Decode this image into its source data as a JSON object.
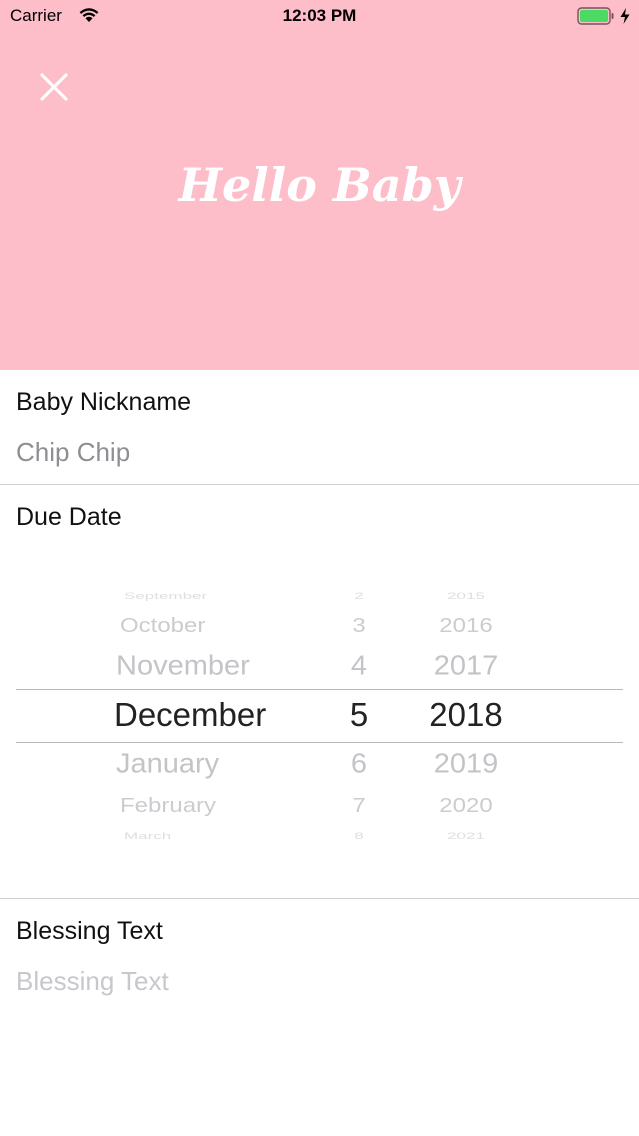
{
  "status_bar": {
    "carrier": "Carrier",
    "time": "12:03 PM",
    "wifi_icon": "wifi-icon",
    "battery_icon": "battery-icon",
    "charge_icon": "charging-bolt-icon",
    "battery_level": 1.0
  },
  "header": {
    "background_color": "#fdbdc9",
    "close_icon": "close-icon",
    "title": "Hello Baby"
  },
  "nickname": {
    "label": "Baby Nickname",
    "value": "Chip Chip"
  },
  "due_date": {
    "label": "Due Date",
    "picker": {
      "months": [
        "September",
        "October",
        "November",
        "December",
        "January",
        "February",
        "March"
      ],
      "days": [
        "2",
        "3",
        "4",
        "5",
        "6",
        "7",
        "8"
      ],
      "years": [
        "2015",
        "2016",
        "2017",
        "2018",
        "2019",
        "2020",
        "2021"
      ],
      "selected": {
        "month": "December",
        "day": "5",
        "year": "2018"
      }
    }
  },
  "blessing": {
    "label": "Blessing Text",
    "placeholder": "Blessing Text",
    "value": ""
  }
}
